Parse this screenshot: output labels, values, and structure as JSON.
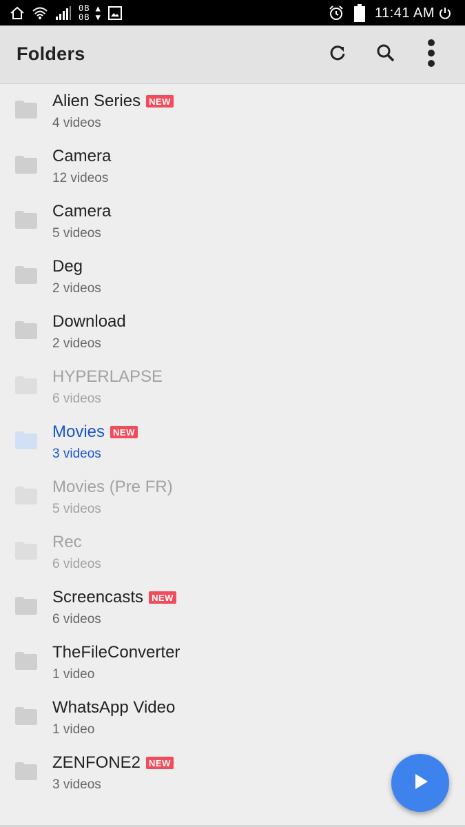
{
  "status_bar": {
    "data_up": "0B",
    "data_down": "0B",
    "time": "11:41 AM",
    "icons": [
      "home-icon",
      "wifi-icon",
      "signal-icon",
      "image-icon",
      "alarm-icon",
      "battery-icon",
      "power-icon"
    ]
  },
  "app_bar": {
    "title": "Folders",
    "actions": [
      "refresh-icon",
      "search-icon",
      "more-vert-icon"
    ]
  },
  "badge_label": "NEW",
  "colors": {
    "accent": "#1a55cf",
    "badge": "#f24b5a",
    "fab": "#3e82ee",
    "background": "#eeeeee"
  },
  "folders": [
    {
      "name": "Alien Series",
      "count": "4 videos",
      "new": true,
      "state": "normal"
    },
    {
      "name": "Camera",
      "count": "12 videos",
      "new": false,
      "state": "normal"
    },
    {
      "name": "Camera",
      "count": "5 videos",
      "new": false,
      "state": "normal"
    },
    {
      "name": "Deg",
      "count": "2 videos",
      "new": false,
      "state": "normal"
    },
    {
      "name": "Download",
      "count": "2 videos",
      "new": false,
      "state": "normal"
    },
    {
      "name": "HYPERLAPSE",
      "count": "6 videos",
      "new": false,
      "state": "dim"
    },
    {
      "name": "Movies",
      "count": "3 videos",
      "new": true,
      "state": "active"
    },
    {
      "name": "Movies (Pre FR)",
      "count": "5 videos",
      "new": false,
      "state": "dim"
    },
    {
      "name": "Rec",
      "count": "6 videos",
      "new": false,
      "state": "dim"
    },
    {
      "name": "Screencasts",
      "count": "6 videos",
      "new": true,
      "state": "normal"
    },
    {
      "name": "TheFileConverter",
      "count": "1 video",
      "new": false,
      "state": "normal"
    },
    {
      "name": "WhatsApp Video",
      "count": "1 video",
      "new": false,
      "state": "normal"
    },
    {
      "name": "ZENFONE2",
      "count": "3 videos",
      "new": true,
      "state": "normal"
    }
  ],
  "fab": {
    "icon": "play-icon"
  }
}
